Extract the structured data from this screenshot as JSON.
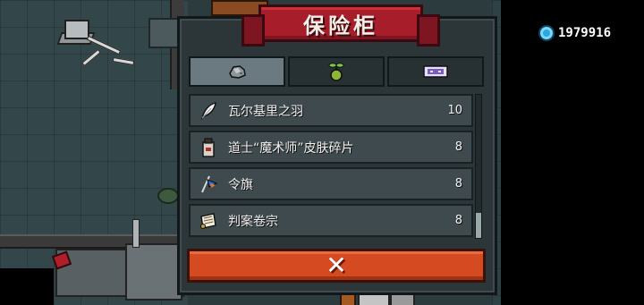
{
  "modal": {
    "title": "保险柜",
    "tabs": [
      {
        "icon": "ore-icon",
        "active": true
      },
      {
        "icon": "seedling-icon",
        "active": false
      },
      {
        "icon": "ticket-icon",
        "active": false
      }
    ],
    "items": [
      {
        "icon": "feather-icon",
        "name": "瓦尔基里之羽",
        "count": "10"
      },
      {
        "icon": "skin-shard-icon",
        "name": "道士“魔术师”皮肤碎片",
        "count": "8"
      },
      {
        "icon": "flag-icon",
        "name": "令旗",
        "count": "8"
      },
      {
        "icon": "scroll-icon",
        "name": "判案卷宗",
        "count": "8"
      }
    ],
    "close_symbol": "✕"
  },
  "hud": {
    "currency_icon": "gem-icon",
    "currency_value": "1979916"
  },
  "colors": {
    "banner": "#a71d29",
    "close_button": "#d64a21",
    "panel": "#2c3538",
    "active_tab": "#6b7a80"
  }
}
